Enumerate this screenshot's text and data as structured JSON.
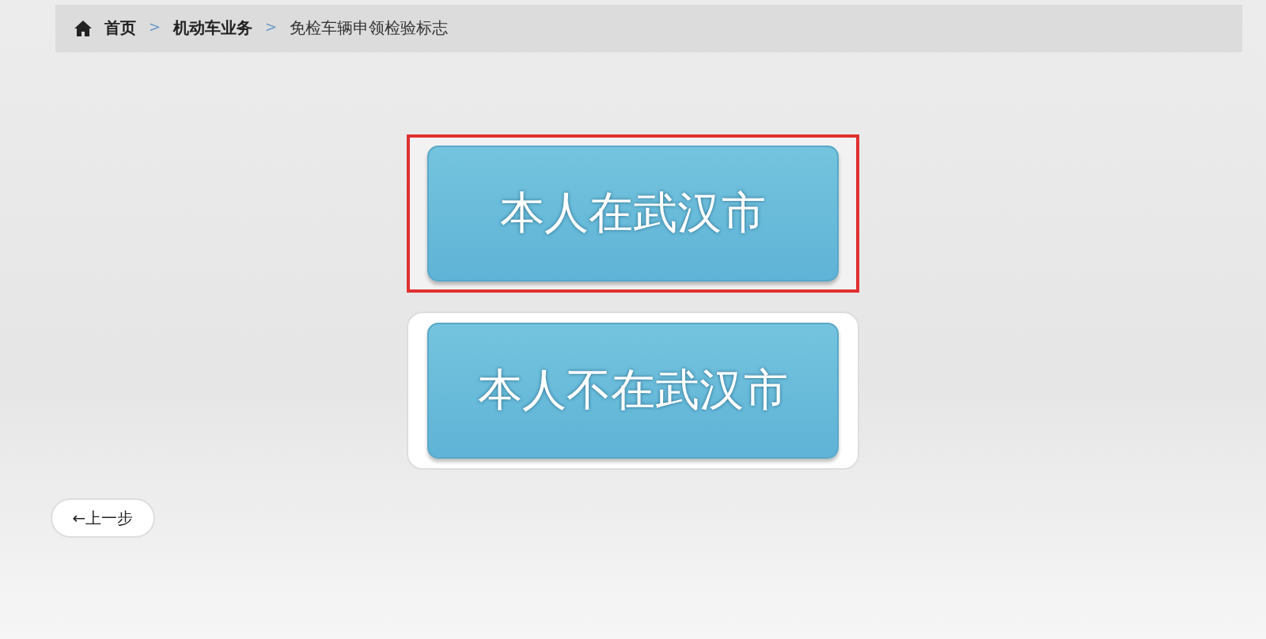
{
  "breadcrumb": [
    {
      "label": "首页",
      "kind": "home"
    },
    {
      "separator": ">",
      "label": "机动车业务",
      "kind": "link"
    },
    {
      "separator": ">",
      "label": "免检车辆申领检验标志",
      "kind": "current"
    }
  ],
  "options": [
    {
      "label": "本人在武汉市",
      "selected": true
    },
    {
      "label": "本人不在武汉市",
      "selected": false
    }
  ],
  "back_button": {
    "label": "←上一步"
  }
}
